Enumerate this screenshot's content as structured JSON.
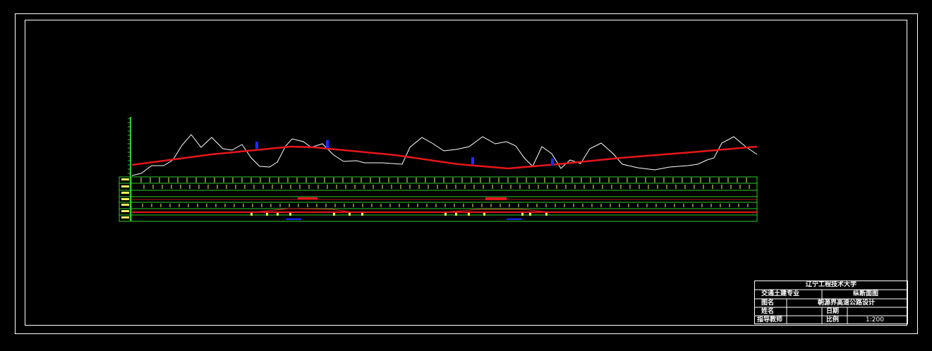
{
  "title_block": {
    "university": "辽宁工程技术大学",
    "major": "交通土建专业",
    "drawing_name": "纵断面图",
    "label_title": "图名",
    "title_value": "朝源界高速公路设计",
    "label_name": "姓名",
    "label_date": "日期",
    "label_advisor": "指导教师",
    "label_scale": "比例",
    "scale_value": "1:200"
  },
  "colors": {
    "background": "#000000",
    "frame": "#ffffff",
    "ground_line": "#ffffff",
    "design_line": "#e8161a",
    "grid": "#2ecc2e",
    "annotation": "#f2f25a",
    "structure": "#1b2bff"
  }
}
